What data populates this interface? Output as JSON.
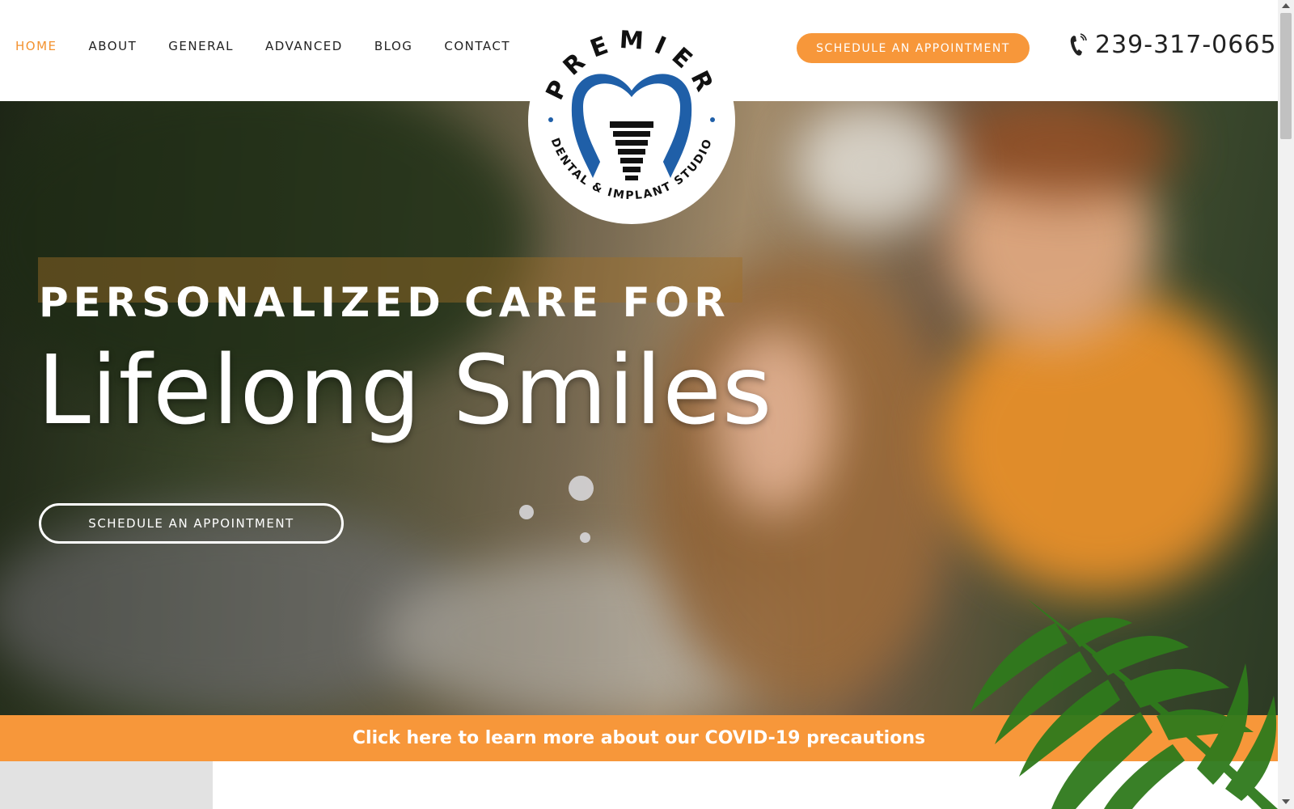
{
  "nav": {
    "items": [
      {
        "label": "HOME",
        "active": true
      },
      {
        "label": "ABOUT",
        "active": false
      },
      {
        "label": "GENERAL",
        "active": false
      },
      {
        "label": "ADVANCED",
        "active": false
      },
      {
        "label": "BLOG",
        "active": false
      },
      {
        "label": "CONTACT",
        "active": false
      }
    ]
  },
  "header": {
    "cta_label": "SCHEDULE AN APPOINTMENT",
    "phone": "239-317-0665",
    "phone_icon": "phone-icon"
  },
  "logo": {
    "top_text": "PREMIER",
    "bottom_text": "DENTAL & IMPLANT STUDIO",
    "icon": "tooth-implant-icon"
  },
  "hero": {
    "subtitle": "PERSONALIZED CARE FOR",
    "title": "Lifelong Smiles",
    "cta_label": "SCHEDULE AN APPOINTMENT"
  },
  "covid_bar": {
    "label": "Click here to learn more about our COVID-19 precautions"
  },
  "colors": {
    "accent": "#f7973a",
    "logo_blue": "#1f5fa8",
    "text_dark": "#222222",
    "white": "#ffffff"
  }
}
